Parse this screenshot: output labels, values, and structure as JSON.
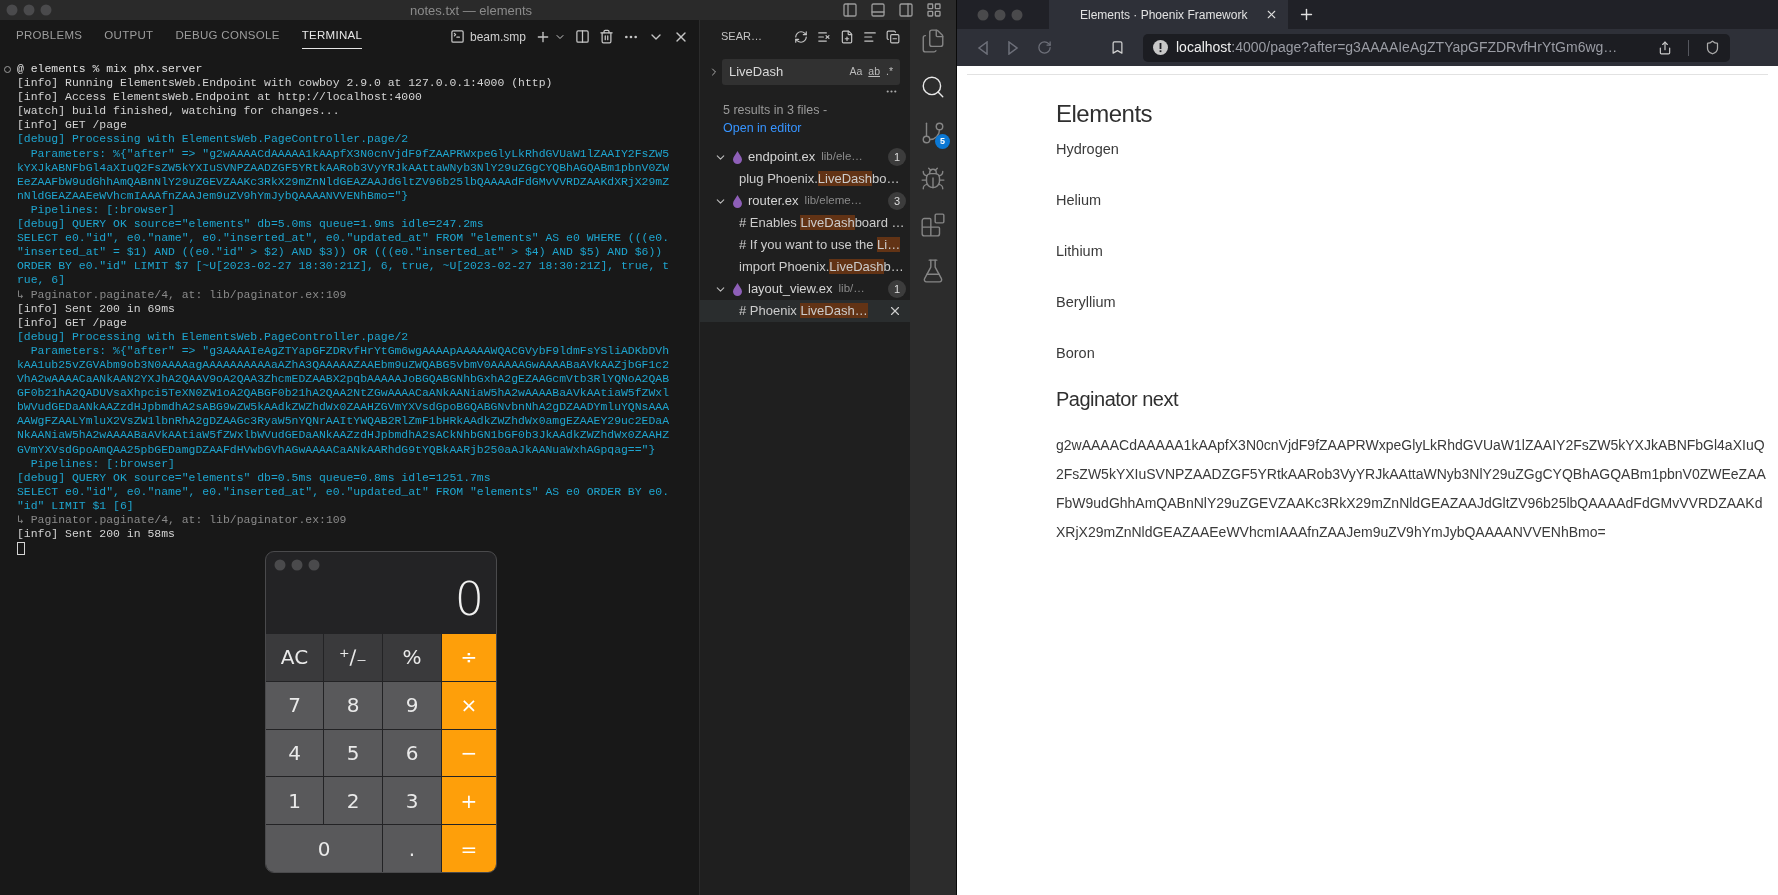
{
  "editor_window": {
    "title": "notes.txt — elements"
  },
  "panel": {
    "tabs": [
      {
        "label": "PROBLEMS",
        "selected": false
      },
      {
        "label": "OUTPUT",
        "selected": false
      },
      {
        "label": "DEBUG CONSOLE",
        "selected": false
      },
      {
        "label": "TERMINAL",
        "selected": true
      }
    ],
    "terminal_name": "beam.smp"
  },
  "terminal": {
    "lines": [
      {
        "kind": "prompt",
        "text": "@ elements % mix phx.server"
      },
      {
        "kind": "info",
        "text": "[info] Running ElementsWeb.Endpoint with cowboy 2.9.0 at 127.0.0.1:4000 (http)"
      },
      {
        "kind": "info",
        "text": "[info] Access ElementsWeb.Endpoint at http://localhost:4000"
      },
      {
        "kind": "info",
        "text": "[watch] build finished, watching for changes..."
      },
      {
        "kind": "info",
        "text": "[info] GET /page"
      },
      {
        "kind": "debug",
        "text": "[debug] Processing with ElementsWeb.PageController.page/2"
      },
      {
        "kind": "debug",
        "text": "  Parameters: %{\"after\" => \"g2wAAAACdAAAAA1kAApfX3N0cnVjdF9fZAAPRWxpeGlyLkRhdGVUaW1lZAAIY2FsZW5"
      },
      {
        "kind": "debug",
        "text": "kYXJkABNFbGl4aXIuQ2FsZW5kYXIuSVNPZAADZGF5YRtkAARob3VyYRJkAAttaWNyb3NlY29uZGgCYQBhAGQABm1pbnV0ZW"
      },
      {
        "kind": "debug",
        "text": "EeZAAFbW9udGhhAmQABnNlY29uZGEVZAAKc3RkX29mZnNldGEAZAAJdGltZV96b25lbQAAAAdFdGMvVVRDZAAKdXRjX29mZ"
      },
      {
        "kind": "debug",
        "text": "nNldGEAZAAEeWVhcmIAAAfnZAAJem9uZV9hYmJybQAAAANVVENhBmo=\"}"
      },
      {
        "kind": "debug",
        "text": "  Pipelines: [:browser]"
      },
      {
        "kind": "debug",
        "text": "[debug] QUERY OK source=\"elements\" db=5.0ms queue=1.9ms idle=247.2ms"
      },
      {
        "kind": "debug",
        "text": "SELECT e0.\"id\", e0.\"name\", e0.\"inserted_at\", e0.\"updated_at\" FROM \"elements\" AS e0 WHERE (((e0."
      },
      {
        "kind": "debug",
        "text": "\"inserted_at\" = $1) AND ((e0.\"id\" > $2) AND $3)) OR (((e0.\"inserted_at\" > $4) AND $5) AND $6))"
      },
      {
        "kind": "debug",
        "text": "ORDER BY e0.\"id\" LIMIT $7 [~U[2023-02-27 18:30:21Z], 6, true, ~U[2023-02-27 18:30:21Z], true, t"
      },
      {
        "kind": "debug",
        "text": "rue, 6]"
      },
      {
        "kind": "trace",
        "text": "↳ Paginator.paginate/4, at: lib/paginator.ex:109"
      },
      {
        "kind": "info",
        "text": "[info] Sent 200 in 69ms"
      },
      {
        "kind": "info",
        "text": "[info] GET /page"
      },
      {
        "kind": "debug",
        "text": "[debug] Processing with ElementsWeb.PageController.page/2"
      },
      {
        "kind": "debug",
        "text": "  Parameters: %{\"after\" => \"g3AAAAIeAgZTYapGFZDRvfHrYtGm6wgAAAApAAAAAWQACGVybF9ldmFsYSliADKbDVh"
      },
      {
        "kind": "debug",
        "text": "kAA1ub25vZGVAbm9ob3N0AAAAagAAAAAAAAAAaAZhA3QAAAAAZAAEbm9uZWQABG5vbmV0AAAAAGwAAAABaAVkAAZjbGF1c2"
      },
      {
        "kind": "debug",
        "text": "VhA2wAAAACaANkAAN2YXJhA2QAAV9oA2QAA3ZhcmEDZAABX2pqbAAAAAJoBGQABGNhbGxhA2gEZAAGcmVtb3RlYQNoA2QAB"
      },
      {
        "kind": "debug",
        "text": "GF0b21hA2QADUVsaXhpci5TeXN0ZW1oA2QABGF0b21hA2QAA2NtZGwAAAACaANkAANiaW5hA2wAAAABaAVkAAtiaW5fZWxl"
      },
      {
        "kind": "debug",
        "text": "bWVudGEDaANkAAZzdHJpbmdhA2sABG9wZW5kAAdkZWZhdWx0ZAAHZGVmYXVsdGpoBGQABGNvbnNhA2gDZAADYmluYQNsAAA"
      },
      {
        "kind": "debug",
        "text": "AAWgFZAALYmluX2VsZW1lbnRhA2gDZAAGc3RyaW5nYQNrAAItYWQAB2RlZmF1bHRkAAdkZWZhdWx0amgEZAAEY29uc2EDaA"
      },
      {
        "kind": "debug",
        "text": "NkAANiaW5hA2wAAAABaAVkAAtiaW5fZWxlbWVudGEDaANkAAZzdHJpbmdhA2sACkNhbGN1bGF0b3JkAAdkZWZhdWx0ZAAHZ"
      },
      {
        "kind": "debug",
        "text": "GVmYXVsdGpoAmQAA25pbGEDamgDZAAFdHVwbGVhAGwAAAACaANkAARhdG9tYQBkAARjb250aAJkAANuaWxhAGpqag==\"}"
      },
      {
        "kind": "debug",
        "text": "  Pipelines: [:browser]"
      },
      {
        "kind": "debug",
        "text": "[debug] QUERY OK source=\"elements\" db=0.5ms queue=0.8ms idle=1251.7ms"
      },
      {
        "kind": "debug",
        "text": "SELECT e0.\"id\", e0.\"name\", e0.\"inserted_at\", e0.\"updated_at\" FROM \"elements\" AS e0 ORDER BY e0."
      },
      {
        "kind": "debug",
        "text": "\"id\" LIMIT $1 [6]"
      },
      {
        "kind": "trace",
        "text": "↳ Paginator.paginate/4, at: lib/paginator.ex:109"
      },
      {
        "kind": "info",
        "text": "[info] Sent 200 in 58ms"
      }
    ]
  },
  "search": {
    "title": "SEAR…",
    "query": "LiveDash",
    "options": [
      "Aa",
      "ab",
      ".*"
    ],
    "summary": "5 results in 3 files - ",
    "open_link": "Open in editor",
    "files": [
      {
        "name": "endpoint.ex",
        "path": "lib/ele…",
        "count": "1",
        "expanded": true,
        "matches": [
          {
            "before": "plug Phoenix.",
            "highlight": "LiveDash",
            "after": "bo…",
            "selected": false
          }
        ]
      },
      {
        "name": "router.ex",
        "path": "lib/eleme…",
        "count": "3",
        "expanded": true,
        "matches": [
          {
            "before": "# Enables ",
            "highlight": "LiveDash",
            "after": "board …",
            "selected": false
          },
          {
            "before": "# If you want to use the ",
            "highlight": "Li…",
            "selected": false
          },
          {
            "before": "import Phoenix.",
            "highlight": "LiveDash",
            "after": "b…",
            "selected": false
          }
        ]
      },
      {
        "name": "layout_view.ex",
        "path": "lib/…",
        "count": "1",
        "expanded": true,
        "matches": [
          {
            "before": "# Phoenix ",
            "highlight": "LiveDash…",
            "selected": true
          }
        ]
      }
    ]
  },
  "activity_bar": {
    "items": [
      {
        "kind": "files",
        "selected": false
      },
      {
        "kind": "search",
        "selected": true
      },
      {
        "kind": "source_control",
        "selected": false,
        "badge": "5"
      },
      {
        "kind": "run",
        "selected": false
      },
      {
        "kind": "extensions",
        "selected": false
      },
      {
        "kind": "testing",
        "selected": false
      }
    ]
  },
  "calculator": {
    "display": "0",
    "keys": [
      {
        "label": "AC",
        "kind": "function"
      },
      {
        "label": "⁺∕₋",
        "kind": "function"
      },
      {
        "label": "%",
        "kind": "function"
      },
      {
        "label": "÷",
        "kind": "operator"
      },
      {
        "label": "7",
        "kind": "digit"
      },
      {
        "label": "8",
        "kind": "digit"
      },
      {
        "label": "9",
        "kind": "digit"
      },
      {
        "label": "×",
        "kind": "operator"
      },
      {
        "label": "4",
        "kind": "digit"
      },
      {
        "label": "5",
        "kind": "digit"
      },
      {
        "label": "6",
        "kind": "digit"
      },
      {
        "label": "−",
        "kind": "operator"
      },
      {
        "label": "1",
        "kind": "digit"
      },
      {
        "label": "2",
        "kind": "digit"
      },
      {
        "label": "3",
        "kind": "digit"
      },
      {
        "label": "+",
        "kind": "operator"
      },
      {
        "label": "0",
        "kind": "digit_wide"
      },
      {
        "label": ".",
        "kind": "digit"
      },
      {
        "label": "=",
        "kind": "operator"
      }
    ]
  },
  "browser": {
    "tab": {
      "title": "Elements · Phoenix Framework"
    },
    "address": {
      "host": "localhost",
      "rest": ":4000/page?after=g3AAAAIeAgZTYapGFZDRvfHrYtGm6wg…"
    },
    "page": {
      "heading": "Elements",
      "items": [
        "Hydrogen",
        "Helium",
        "Lithium",
        "Beryllium",
        "Boron"
      ],
      "subheading": "Paginator next",
      "token": "g2wAAAACdAAAAA1kAApfX3N0cnVjdF9fZAAPRWxpeGlyLkRhdGVUaW1lZAAIY2FsZW5kYXJkABNFbGl4aXIuQ2FsZW5kYXIuSVNPZAADZGF5YRtkAARob3VyYRJkAAttaWNyb3NlY29uZGgCYQBhAGQABm1pbnV0ZWEeZAAFbW9udGhhAmQABnNlY29uZGEVZAAKc3RkX29mZnNldGEAZAAJdGltZV96b25lbQAAAAdFdGMvVVRDZAAKdXRjX29mZnNldGEAZAAEeWVhcmIAAAfnZAAJem9uZV9hYmJybQAAAANVVENhBmo="
    }
  }
}
